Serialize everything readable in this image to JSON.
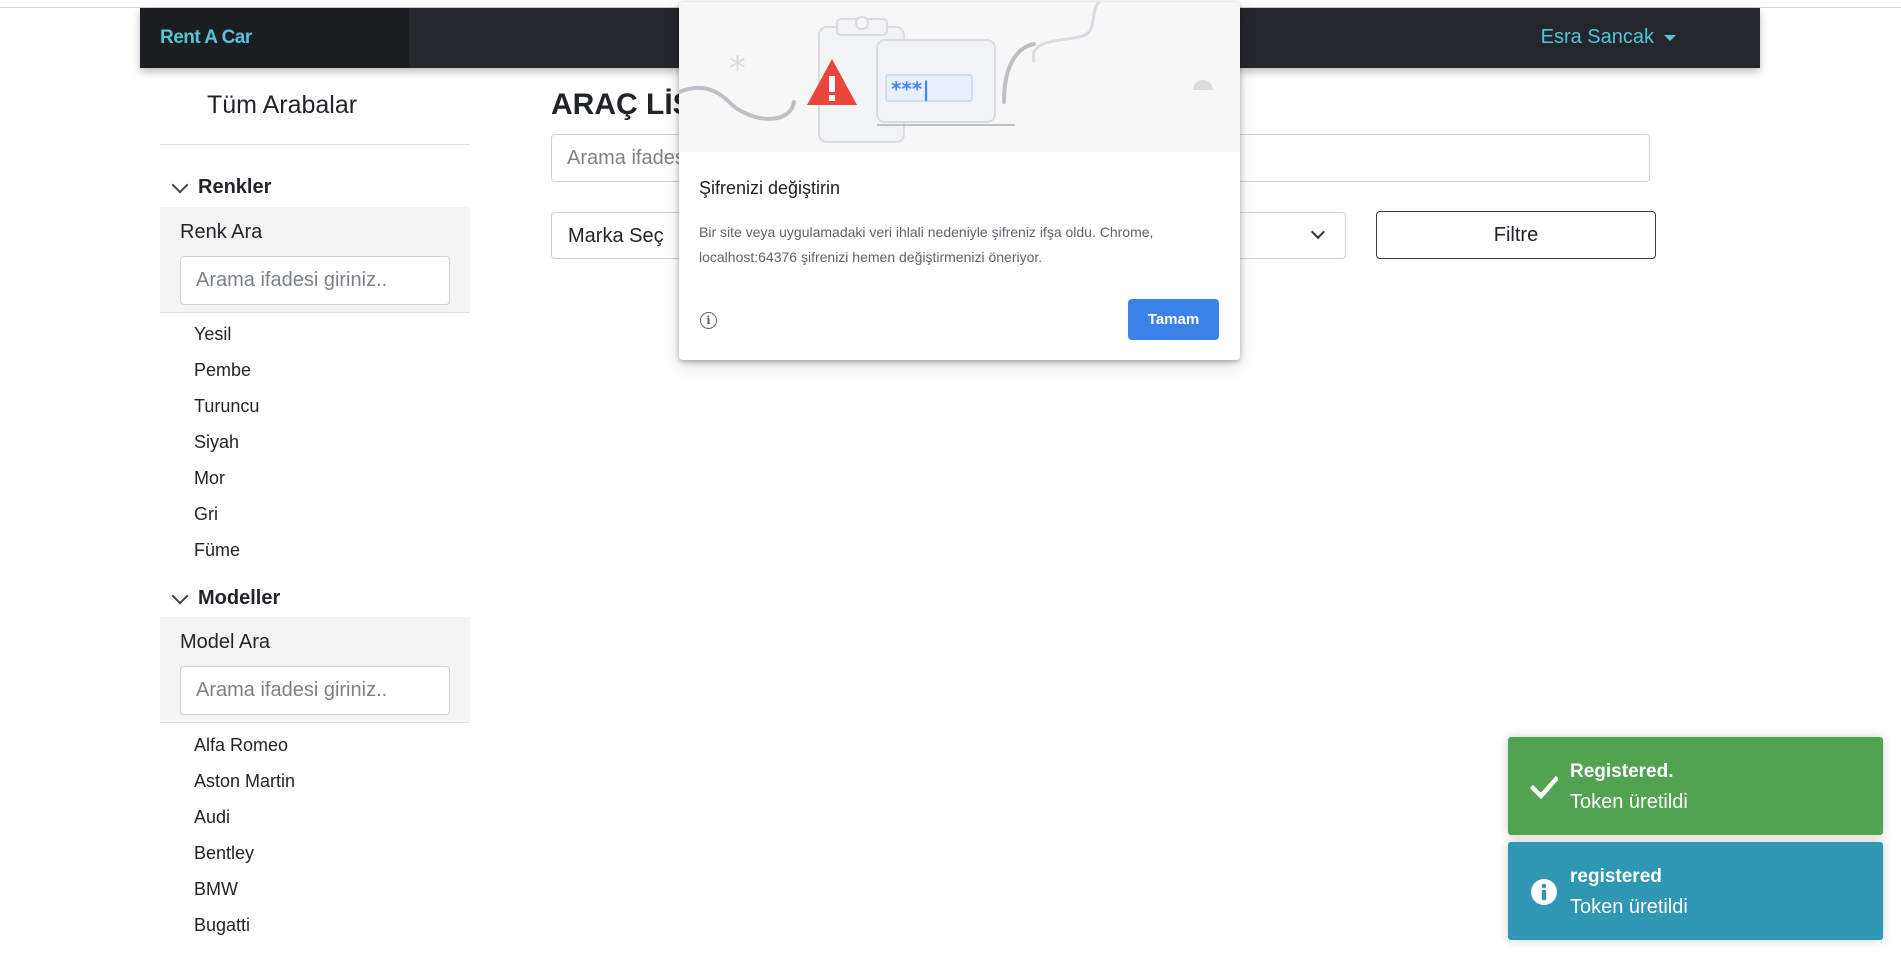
{
  "navbar": {
    "brand": "Rent A Car",
    "user_name": "Esra Sancak",
    "brand_color": "#58c3d6",
    "background": "#23272c"
  },
  "sidebar": {
    "title": "Tüm Arabalar",
    "colors_section": {
      "heading": "Renkler",
      "search_label": "Renk Ara",
      "search_placeholder": "Arama ifadesi giriniz..",
      "items": [
        "Yesil",
        "Pembe",
        "Turuncu",
        "Siyah",
        "Mor",
        "Gri",
        "Füme"
      ]
    },
    "models_section": {
      "heading": "Modeller",
      "search_label": "Model Ara",
      "search_placeholder": "Arama ifadesi giriniz..",
      "items": [
        "Alfa Romeo",
        "Aston Martin",
        "Audi",
        "Bentley",
        "BMW",
        "Bugatti"
      ]
    }
  },
  "main": {
    "title": "ARAÇ LİSTESİ",
    "search_placeholder": "Arama ifadesi giriniz..",
    "brand_select": "Marka Seç",
    "filter_button": "Filtre"
  },
  "password_popup": {
    "title": "Şifrenizi değiştirin",
    "body": "Bir site veya uygulamadaki veri ihlali nedeniyle şifreniz ifşa oldu. Chrome, localhost:64376 şifrenizi hemen değiştirmenizi öneriyor.",
    "ok_button": "Tamam",
    "info_icon": "info-icon",
    "masked_text": "***|"
  },
  "toasts": [
    {
      "type": "success",
      "title": "Registered.",
      "message": "Token üretildi",
      "color": "#51a351",
      "icon": "check-icon"
    },
    {
      "type": "info",
      "title": "registered",
      "message": "Token üretildi",
      "color": "#2f96b4",
      "icon": "info-icon"
    }
  ]
}
